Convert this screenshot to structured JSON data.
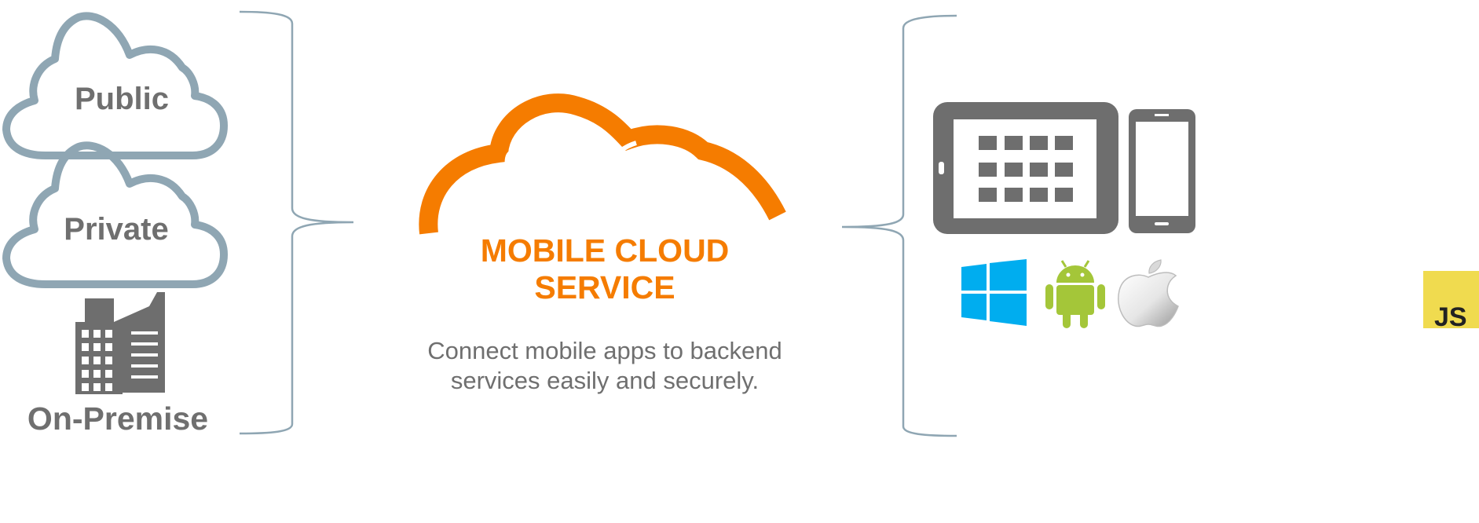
{
  "sources": {
    "public_label": "Public",
    "private_label": "Private",
    "onpremise_label": "On-Premise"
  },
  "center": {
    "title_line1": "MOBILE CLOUD",
    "title_line2": "SERVICE",
    "subtitle_line1": "Connect mobile apps to backend",
    "subtitle_line2": "services easily and securely."
  },
  "platforms": {
    "icons": [
      "windows-logo",
      "android-logo",
      "apple-logo",
      "javascript-logo"
    ],
    "js_label": "JS"
  },
  "colors": {
    "accent": "#f57c00",
    "cloud_outline": "#8fa6b3",
    "text_gray": "#6f6f6f",
    "device_gray": "#6e6e6e",
    "windows_blue": "#00adef",
    "android_green": "#a4c639",
    "js_yellow": "#f0db4f"
  }
}
